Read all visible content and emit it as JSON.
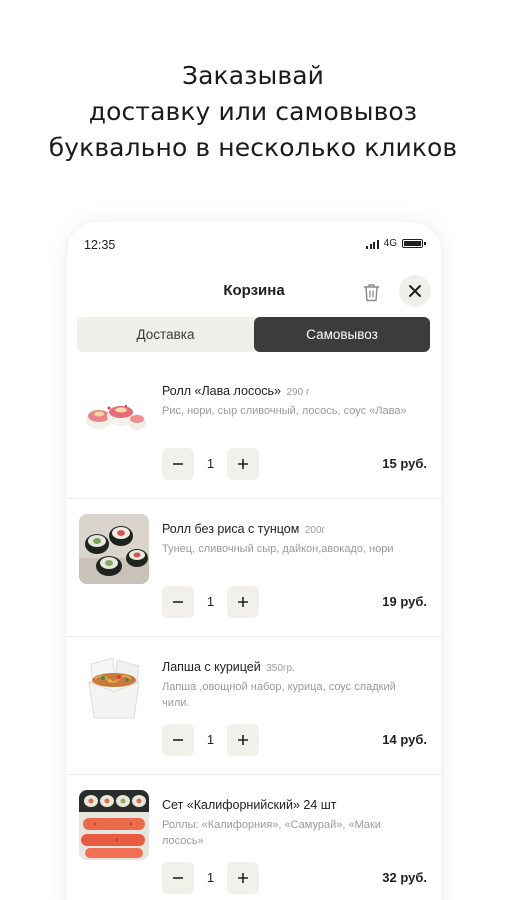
{
  "headline": {
    "line1": "Заказывай",
    "line2": "доставку или самовывоз",
    "line3": "буквально в несколько кликов"
  },
  "status_bar": {
    "time": "12:35",
    "network": "4G",
    "icons": [
      "signal-icon",
      "battery-icon"
    ]
  },
  "cart": {
    "title": "Корзина",
    "trash_icon": "trash-icon",
    "close_icon": "close-icon",
    "tabs": [
      {
        "label": "Доставка",
        "active": false
      },
      {
        "label": "Самовывоз",
        "active": true
      }
    ],
    "items": [
      {
        "name": "Ролл «Лава лосось»",
        "weight": "290 г",
        "description": "Рис, нори, сыр сливочный, лосось, соус «Лава»",
        "quantity": "1",
        "price": "15 руб.",
        "image": "roll-lava-image"
      },
      {
        "name": "Ролл без риса с тунцом",
        "weight": "200г",
        "description": "Тунец, сливочный сыр, дайкон,авокадо, нори",
        "quantity": "1",
        "price": "19 руб.",
        "image": "roll-tuna-image"
      },
      {
        "name": "Лапша с курицей",
        "weight": "350гр.",
        "description": "Лапша ,овощной набор, курица, соус сладкий чили.",
        "quantity": "1",
        "price": "14 руб.",
        "image": "noodles-image"
      },
      {
        "name": "Сет «Калифорнийский» 24 шт",
        "weight": "",
        "description": "Роллы: «Калифорния», «Самурай», «Маки лосось»",
        "quantity": "1",
        "price": "32 руб.",
        "image": "set-california-image"
      }
    ]
  },
  "colors": {
    "accent_dark": "#3c3c3c",
    "soft_bg": "#f1efe9",
    "muted_text": "#9a9a9a"
  }
}
